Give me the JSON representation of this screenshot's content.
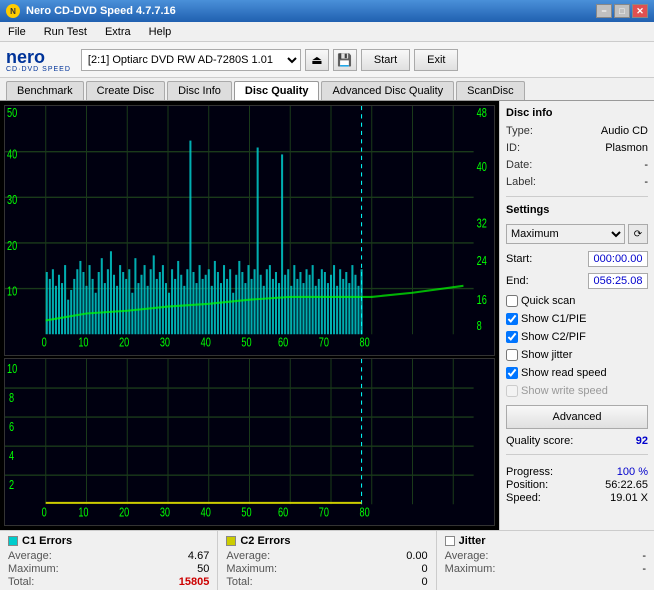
{
  "window": {
    "title": "Nero CD-DVD Speed 4.7.7.16",
    "title_btn_min": "−",
    "title_btn_max": "□",
    "title_btn_close": "✕"
  },
  "menu": {
    "items": [
      "File",
      "Run Test",
      "Extra",
      "Help"
    ]
  },
  "toolbar": {
    "logo_text": "nero",
    "logo_sub": "CD·DVD SPEED",
    "drive_label": "[2:1] Optiarc DVD RW AD-7280S 1.01",
    "start_label": "Start",
    "exit_label": "Exit"
  },
  "tabs": [
    {
      "label": "Benchmark",
      "active": false
    },
    {
      "label": "Create Disc",
      "active": false
    },
    {
      "label": "Disc Info",
      "active": false
    },
    {
      "label": "Disc Quality",
      "active": true
    },
    {
      "label": "Advanced Disc Quality",
      "active": false
    },
    {
      "label": "ScanDisc",
      "active": false
    }
  ],
  "disc_info": {
    "section_title": "Disc info",
    "type_label": "Type:",
    "type_value": "Audio CD",
    "id_label": "ID:",
    "id_value": "Plasmon",
    "date_label": "Date:",
    "date_value": "-",
    "label_label": "Label:",
    "label_value": "-"
  },
  "settings": {
    "section_title": "Settings",
    "speed_value": "Maximum",
    "start_label": "Start:",
    "start_value": "000:00.00",
    "end_label": "End:",
    "end_value": "056:25.08",
    "quick_scan_label": "Quick scan",
    "quick_scan_checked": false,
    "show_c1pie_label": "Show C1/PIE",
    "show_c1pie_checked": true,
    "show_c2pif_label": "Show C2/PIF",
    "show_c2pif_checked": true,
    "show_jitter_label": "Show jitter",
    "show_jitter_checked": false,
    "show_read_speed_label": "Show read speed",
    "show_read_speed_checked": true,
    "show_write_speed_label": "Show write speed",
    "show_write_speed_checked": false,
    "advanced_btn_label": "Advanced"
  },
  "quality": {
    "score_label": "Quality score:",
    "score_value": "92"
  },
  "progress": {
    "progress_label": "Progress:",
    "progress_value": "100 %",
    "position_label": "Position:",
    "position_value": "56:22.65",
    "speed_label": "Speed:",
    "speed_value": "19.01 X"
  },
  "c1_errors": {
    "title": "C1 Errors",
    "color": "#00cccc",
    "average_label": "Average:",
    "average_value": "4.67",
    "maximum_label": "Maximum:",
    "maximum_value": "50",
    "total_label": "Total:",
    "total_value": "15805"
  },
  "c2_errors": {
    "title": "C2 Errors",
    "color": "#cccc00",
    "average_label": "Average:",
    "average_value": "0.00",
    "maximum_label": "Maximum:",
    "maximum_value": "0",
    "total_label": "Total:",
    "total_value": "0"
  },
  "jitter": {
    "title": "Jitter",
    "color": "#ffffff",
    "average_label": "Average:",
    "average_value": "-",
    "maximum_label": "Maximum:",
    "maximum_value": "-"
  }
}
